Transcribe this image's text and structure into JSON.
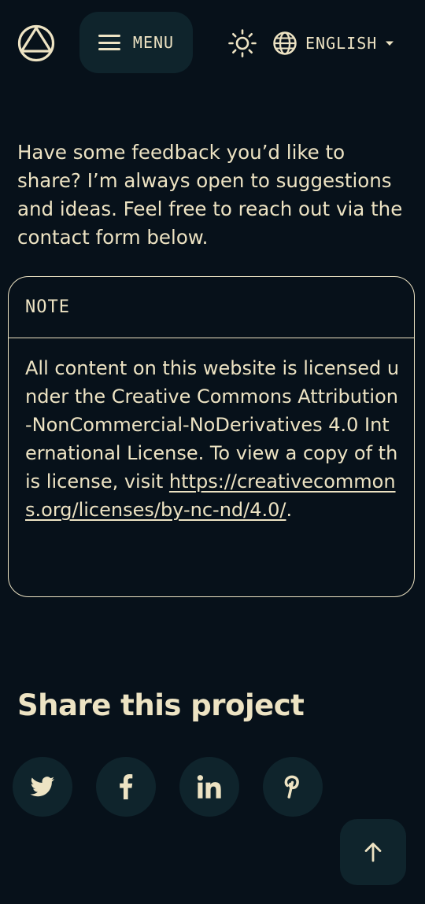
{
  "header": {
    "logo_icon": "triangle-in-circle-logo",
    "menu_label": "MENU",
    "menu_icon": "hamburger-icon",
    "theme_icon": "sun-icon",
    "language": {
      "icon": "globe-icon",
      "selected": "ENGLISH",
      "caret_icon": "caret-down-icon"
    }
  },
  "intro": {
    "text": "Have some feedback you’d like to share? I’m always open to suggestions and ideas. Feel free to reach out via the contact form below."
  },
  "note": {
    "title": "NOTE",
    "body": "All content on this website is licensed under the Creative Commons Attribution-NonCommercial-NoDerivatives 4.0 International License. To view a copy of this license, visit ",
    "link_text": "https://creativecommons.org/licenses/by-nc-nd/4.0/",
    "trailing": "."
  },
  "share": {
    "title": "Share this project",
    "buttons": [
      {
        "icon": "twitter-icon"
      },
      {
        "icon": "facebook-icon"
      },
      {
        "icon": "linkedin-icon"
      },
      {
        "icon": "pinterest-icon"
      }
    ]
  },
  "back_to_top": {
    "icon": "arrow-up-icon"
  },
  "colors": {
    "background": "#07111a",
    "surface": "#0f242c",
    "text": "#ede3c3"
  }
}
